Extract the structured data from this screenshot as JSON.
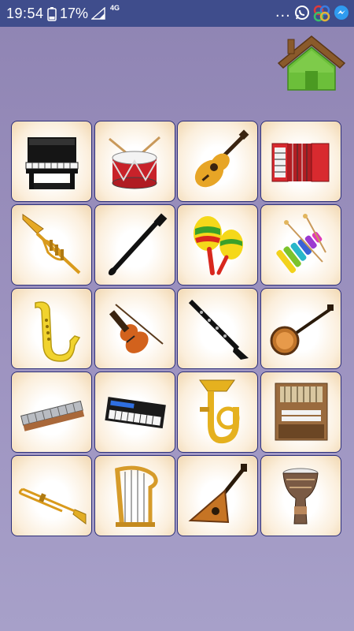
{
  "status_bar": {
    "time": "19:54",
    "battery": "17%",
    "network": "4G",
    "overflow": "...",
    "icons": [
      "battery-icon",
      "signal-icon",
      "whatsapp-icon",
      "app-icon",
      "messenger-icon"
    ]
  },
  "header": {
    "home_icon": "home-icon"
  },
  "instruments": [
    {
      "id": "piano"
    },
    {
      "id": "drum"
    },
    {
      "id": "guitar"
    },
    {
      "id": "accordion"
    },
    {
      "id": "trumpet"
    },
    {
      "id": "recorder"
    },
    {
      "id": "maracas"
    },
    {
      "id": "xylophone"
    },
    {
      "id": "saxophone"
    },
    {
      "id": "violin"
    },
    {
      "id": "clarinet"
    },
    {
      "id": "banjo"
    },
    {
      "id": "harmonica"
    },
    {
      "id": "keyboard"
    },
    {
      "id": "tuba"
    },
    {
      "id": "organ"
    },
    {
      "id": "trombone"
    },
    {
      "id": "harp"
    },
    {
      "id": "balalaika"
    },
    {
      "id": "darbuka"
    }
  ],
  "colors": {
    "status_bar": "#3f4d8c",
    "tile_border": "#2c2f7a",
    "background": "#9d93c0",
    "home_green": "#6cbf3a",
    "home_roof": "#8a5a2b"
  }
}
